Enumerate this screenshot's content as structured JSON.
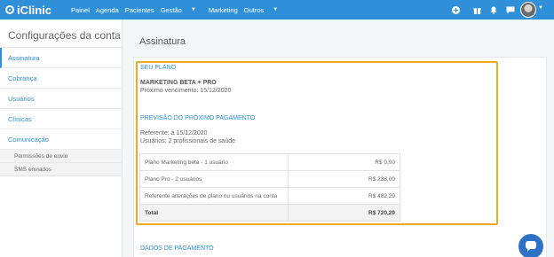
{
  "app": {
    "logo_text": "iClinic"
  },
  "nav": {
    "items": [
      {
        "label": "Painel"
      },
      {
        "label": "Agenda"
      },
      {
        "label": "Pacientes"
      },
      {
        "label": "Gestão",
        "has_caret": true
      },
      {
        "label": "Marketing"
      },
      {
        "label": "Outros",
        "has_caret": true
      }
    ],
    "icons": [
      "add-icon",
      "gift-icon",
      "bell-icon",
      "chat-icon",
      "avatar"
    ]
  },
  "sidebar": {
    "title": "Configurações da conta",
    "items": [
      {
        "label": "Assinatura",
        "active": true
      },
      {
        "label": "Cobrança"
      },
      {
        "label": "Usuários"
      },
      {
        "label": "Clínicas"
      },
      {
        "label": "Comunicação"
      }
    ],
    "sub_items": [
      {
        "label": "Permissões de envio"
      },
      {
        "label": "SMS enviados"
      }
    ]
  },
  "main": {
    "title": "Assinatura",
    "plan": {
      "heading": "SEU PLANO",
      "name": "MARKETING BETA + PRO",
      "due": "Próximo vencimento: 15/12/2020"
    },
    "forecast": {
      "heading": "PREVISÃO DO PRÓXIMO PAGAMENTO",
      "reference": "Referente: à 15/12/2020",
      "users": "Usuários: 2 profissionais de saúde",
      "rows": [
        {
          "label": "Plano Marketing beta - 1 usuário",
          "value": "R$ 0,00"
        },
        {
          "label": "Plano Pro - 2 usuários",
          "value": "R$ 238,00"
        },
        {
          "label": "Referente alterações de plano ou usuários na conta",
          "value": "R$ 482,29"
        }
      ],
      "total_label": "Total",
      "total_value": "R$ 720,29"
    },
    "payment": {
      "heading": "DADOS DE PAGAMENTO"
    }
  },
  "colors": {
    "brand": "#2f8fd8",
    "highlight": "#f5a623",
    "chat": "#2e72c7"
  }
}
